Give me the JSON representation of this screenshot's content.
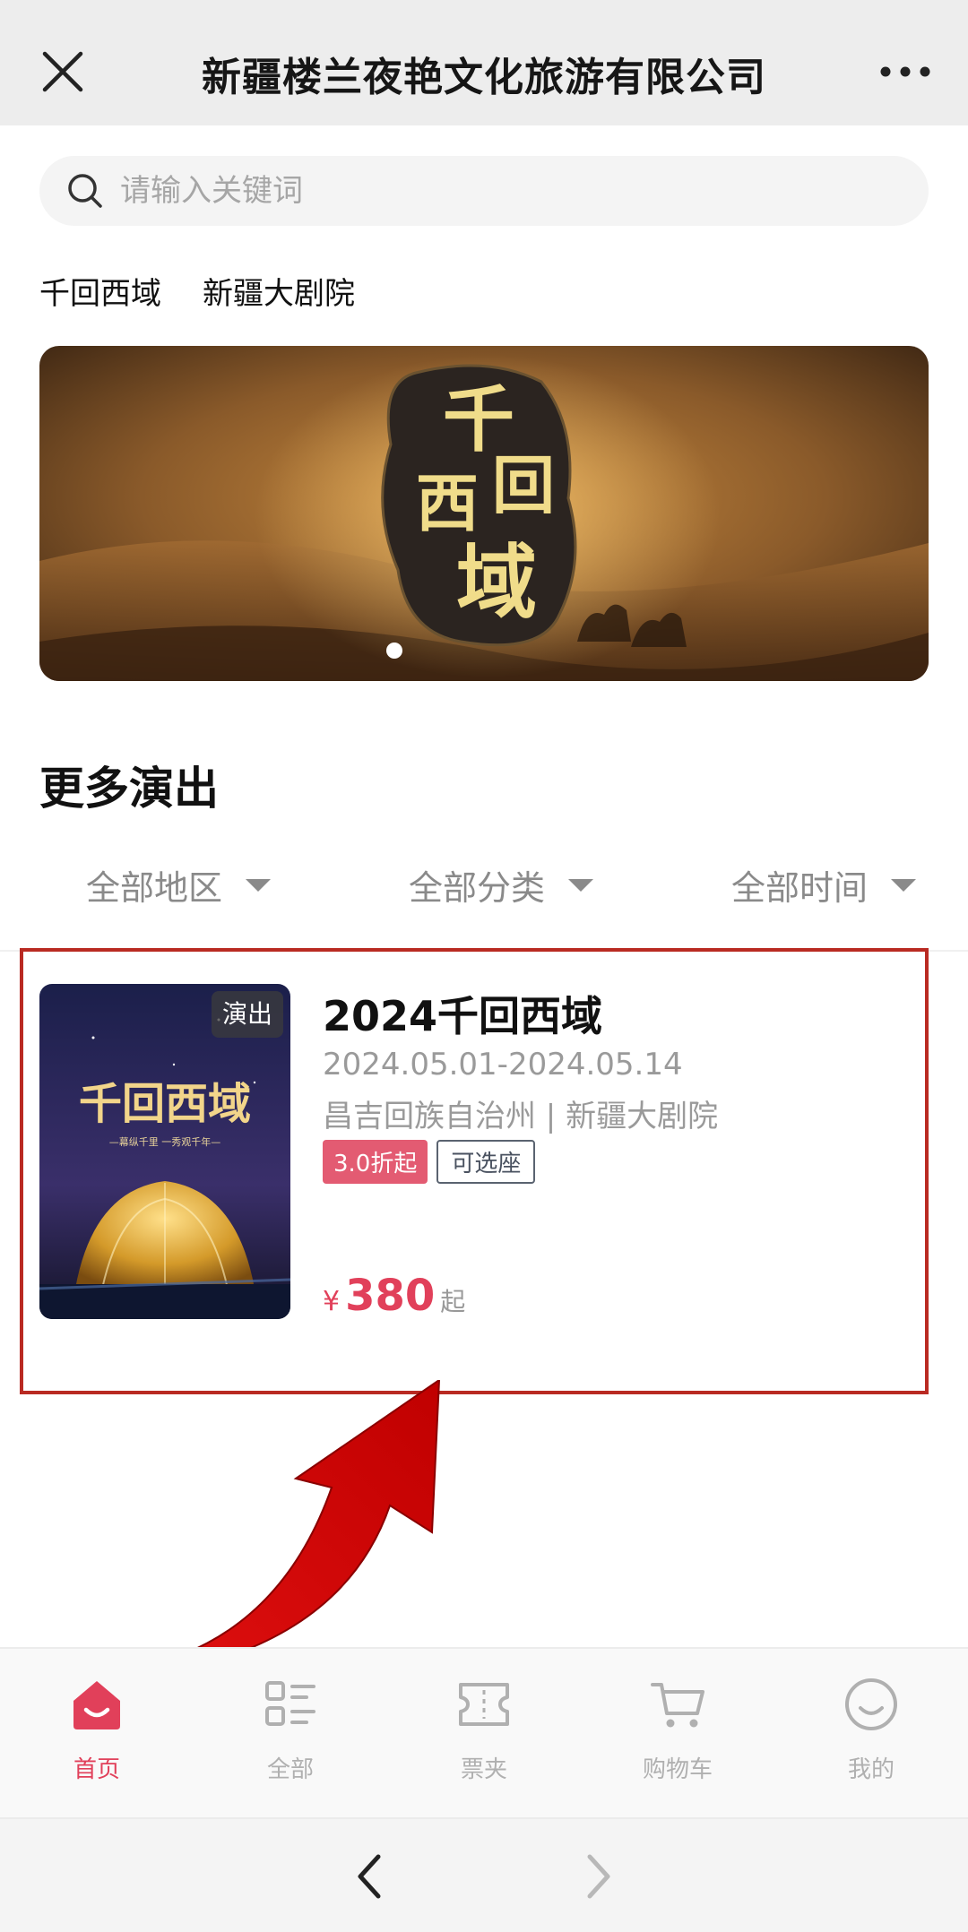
{
  "titlebar": {
    "title": "新疆楼兰夜艳文化旅游有限公司"
  },
  "search": {
    "placeholder": "请输入关键词"
  },
  "quick_links": [
    "千回西域",
    "新疆大剧院"
  ],
  "banner": {
    "art_text": "千回西域"
  },
  "section": {
    "title": "更多演出"
  },
  "filters": {
    "region": "全部地区",
    "category": "全部分类",
    "time": "全部时间"
  },
  "show": {
    "poster_tag": "演出",
    "title": "2024千回西域",
    "date": "2024.05.01-2024.05.14",
    "venue": "昌吉回族自治州 | 新疆大剧院",
    "discount": "3.0折起",
    "seat_tag": "可选座",
    "currency": "¥",
    "price": "380",
    "price_suffix": "起",
    "poster_title": "千回西域",
    "poster_subtitle": "—幕纵千里 一秀观千年—"
  },
  "tabs": [
    {
      "label": "首页",
      "icon": "home-icon",
      "active": true
    },
    {
      "label": "全部",
      "icon": "grid-list-icon",
      "active": false
    },
    {
      "label": "票夹",
      "icon": "ticket-icon",
      "active": false
    },
    {
      "label": "购物车",
      "icon": "cart-icon",
      "active": false
    },
    {
      "label": "我的",
      "icon": "smile-icon",
      "active": false
    }
  ],
  "colors": {
    "accent": "#e1405a",
    "highlight_border": "#b92a22",
    "muted_text": "#9a9a9a"
  }
}
